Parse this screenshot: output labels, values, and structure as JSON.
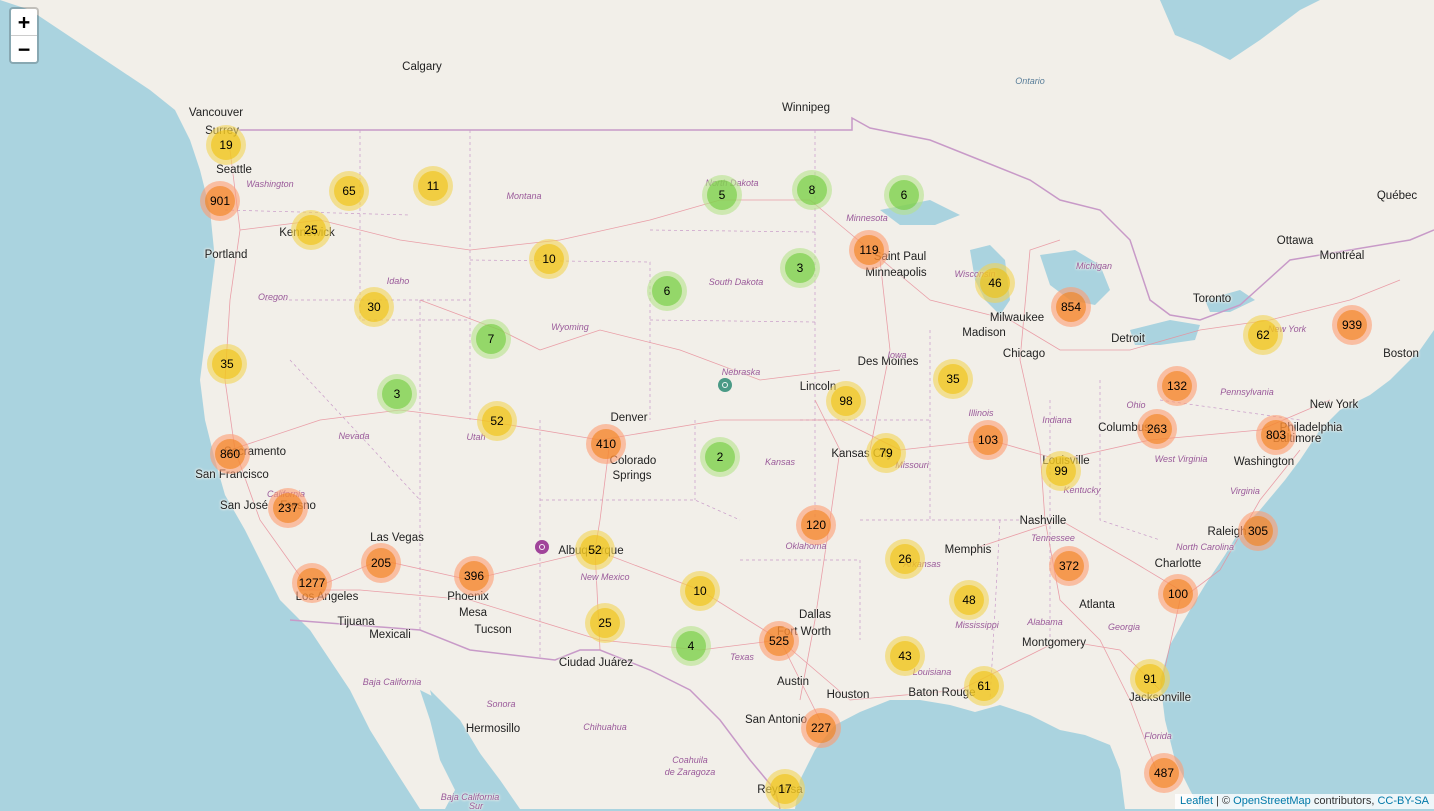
{
  "zoom": {
    "in_label": "+",
    "out_label": "−"
  },
  "attribution": {
    "leaflet": "Leaflet",
    "sep": " | © ",
    "osm": "OpenStreetMap",
    "contrib": " contributors, ",
    "license": "CC-BY-SA"
  },
  "colors": {
    "small": "#6ecc39",
    "medium": "#f0c20c",
    "large": "#f18017",
    "water": "#aad3df",
    "land": "#f2efe9",
    "border": "#c89ac8",
    "road": "#e8909c"
  },
  "clusters": [
    {
      "count": "19",
      "size": "medium"
    },
    {
      "count": "901",
      "size": "large"
    },
    {
      "count": "65",
      "size": "medium"
    },
    {
      "count": "11",
      "size": "medium"
    },
    {
      "count": "25",
      "size": "medium"
    },
    {
      "count": "10",
      "size": "medium"
    },
    {
      "count": "30",
      "size": "medium"
    },
    {
      "count": "35",
      "size": "medium"
    },
    {
      "count": "7",
      "size": "small"
    },
    {
      "count": "3",
      "size": "small"
    },
    {
      "count": "52",
      "size": "medium"
    },
    {
      "count": "860",
      "size": "large"
    },
    {
      "count": "237",
      "size": "large"
    },
    {
      "count": "205",
      "size": "large"
    },
    {
      "count": "1277",
      "size": "large"
    },
    {
      "count": "396",
      "size": "large"
    },
    {
      "count": "410",
      "size": "large"
    },
    {
      "count": "52",
      "size": "medium"
    },
    {
      "count": "25",
      "size": "medium"
    },
    {
      "count": "5",
      "size": "small"
    },
    {
      "count": "6",
      "size": "small"
    },
    {
      "count": "8",
      "size": "small"
    },
    {
      "count": "3",
      "size": "small"
    },
    {
      "count": "6",
      "size": "small"
    },
    {
      "count": "119",
      "size": "large"
    },
    {
      "count": "2",
      "size": "small"
    },
    {
      "count": "10",
      "size": "medium"
    },
    {
      "count": "4",
      "size": "small"
    },
    {
      "count": "525",
      "size": "large"
    },
    {
      "count": "120",
      "size": "large"
    },
    {
      "count": "98",
      "size": "medium"
    },
    {
      "count": "79",
      "size": "medium"
    },
    {
      "count": "26",
      "size": "medium"
    },
    {
      "count": "43",
      "size": "medium"
    },
    {
      "count": "227",
      "size": "large"
    },
    {
      "count": "17",
      "size": "medium"
    },
    {
      "count": "46",
      "size": "medium"
    },
    {
      "count": "35",
      "size": "medium"
    },
    {
      "count": "103",
      "size": "large"
    },
    {
      "count": "48",
      "size": "medium"
    },
    {
      "count": "61",
      "size": "medium"
    },
    {
      "count": "854",
      "size": "large"
    },
    {
      "count": "99",
      "size": "medium"
    },
    {
      "count": "372",
      "size": "large"
    },
    {
      "count": "132",
      "size": "large"
    },
    {
      "count": "263",
      "size": "large"
    },
    {
      "count": "62",
      "size": "medium"
    },
    {
      "count": "939",
      "size": "large"
    },
    {
      "count": "803",
      "size": "large"
    },
    {
      "count": "305",
      "size": "large"
    },
    {
      "count": "100",
      "size": "large"
    },
    {
      "count": "91",
      "size": "medium"
    },
    {
      "count": "487",
      "size": "large"
    }
  ],
  "markers": [
    {
      "color": "#4a9a86"
    },
    {
      "color": "#a0449a"
    }
  ],
  "labels": {
    "cities": [
      "Calgary",
      "Vancouver",
      "Surrey",
      "Seattle",
      "Portland",
      "Kennewick",
      "Winnipeg",
      "Saint Paul",
      "Minneapolis",
      "Milwaukee",
      "Madison",
      "Chicago",
      "Detroit",
      "Toronto",
      "Ottawa",
      "Montréal",
      "Québec",
      "Boston",
      "New York",
      "Philadelphia",
      "Baltimore",
      "Washington",
      "Columbus",
      "Louisville",
      "Nashville",
      "Charlotte",
      "Raleigh",
      "Atlanta",
      "Jacksonville",
      "Memphis",
      "Montgomery",
      "Baton Rouge",
      "Houston",
      "Austin",
      "San Antonio",
      "Dallas",
      "Fort Worth",
      "Kansas City",
      "Lincoln",
      "Des Moines",
      "Denver",
      "Colorado",
      "Springs",
      "Albuquerque",
      "Ciudad Juárez",
      "Phoenix",
      "Mesa",
      "Tucson",
      "Las Vegas",
      "Los Angeles",
      "Tijuana",
      "Mexicali",
      "San Francisco",
      "Sacramento",
      "San José",
      "Fresno",
      "Hermosillo",
      "Reynosa"
    ],
    "regions": [
      "Washington",
      "Oregon",
      "Idaho",
      "Montana",
      "Wyoming",
      "Nevada",
      "Utah",
      "North Dakota",
      "South Dakota",
      "Nebraska",
      "Kansas",
      "Oklahoma",
      "Texas",
      "New Mexico",
      "Minnesota",
      "Iowa",
      "Missouri",
      "Arkansas",
      "Louisiana",
      "Mississippi",
      "Alabama",
      "Georgia",
      "Tennessee",
      "Kentucky",
      "Illinois",
      "Indiana",
      "Ohio",
      "Michigan",
      "Wisconsin",
      "Pennsylvania",
      "West Virginia",
      "Virginia",
      "North Carolina",
      "Florida",
      "New York",
      "California",
      "Baja California",
      "Sonora",
      "Chihuahua",
      "Coahuila",
      "de Zaragoza",
      "Baja California",
      "Sur"
    ],
    "water": [
      "Ontario"
    ]
  }
}
